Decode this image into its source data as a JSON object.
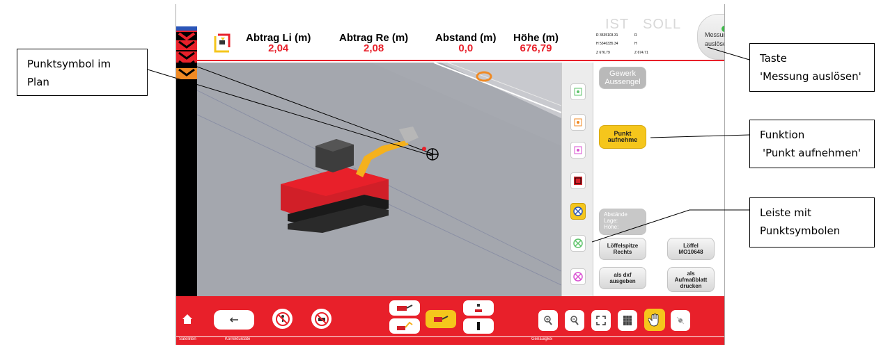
{
  "callouts": {
    "plan_symbol": [
      "Punktsymbol im",
      "Plan"
    ],
    "measure_key": [
      "Taste",
      "'Messung auslösen'"
    ],
    "function": [
      "Funktion",
      "'Punkt aufnehmen'"
    ],
    "strip": [
      "Leiste mit",
      "Punktsymbolen"
    ]
  },
  "header": {
    "measurements": [
      {
        "label": "Abtrag Li (m)",
        "value": "2,04"
      },
      {
        "label": "Abtrag Re (m)",
        "value": "2,08"
      },
      {
        "label": "Abstand (m)",
        "value": "0,0"
      },
      {
        "label": "Höhe (m)",
        "value": "676,79"
      }
    ],
    "ist_label": "IST",
    "soll_label": "SOLL",
    "ist_coords": [
      "R 3535103.31",
      "H 5346335.34",
      "Z 676.79"
    ],
    "soll_coords": [
      "R",
      "H",
      "Z 674.71"
    ],
    "measure_button": [
      "Messung",
      "auslösen"
    ]
  },
  "panel": {
    "gewerk": [
      "Gewerk",
      "Aussengel"
    ],
    "punkt": [
      "Punkt",
      "aufnehme"
    ],
    "abstaende": [
      "Abstände",
      "Lage:",
      "Höhe:"
    ],
    "loeffelspitze": [
      "Löffelspitze",
      "Rechts"
    ],
    "loeffel": [
      "Löffel",
      "MO10648"
    ],
    "dxf": [
      "als dxf",
      "ausgeben"
    ],
    "aufmass": [
      "als",
      "Aufmaßblatt",
      "drucken"
    ]
  },
  "symbols": [
    {
      "name": "square-dot-green-icon",
      "color": "#5ec36a"
    },
    {
      "name": "square-dot-orange-icon",
      "color": "#f08a24"
    },
    {
      "name": "square-dot-magenta-icon",
      "color": "#d94fd2"
    },
    {
      "name": "square-red-icon",
      "color": "#d8222a"
    },
    {
      "name": "circle-cross-blue-icon",
      "color": "#2a55b8"
    },
    {
      "name": "circle-cross-green-icon",
      "color": "#5ec36a"
    },
    {
      "name": "circle-cross-magenta-icon",
      "color": "#d94fd2"
    }
  ],
  "statusbar": {
    "satelliten": "Satelliten",
    "korrektur": "Korrekturdate",
    "genauigkeit": "Genauigkei"
  },
  "colors": {
    "accent": "#e8202a",
    "highlight": "#f5c61c"
  }
}
